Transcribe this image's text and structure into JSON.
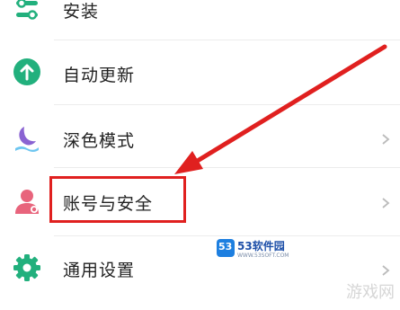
{
  "settings": {
    "items": [
      {
        "label": "安装",
        "icon": "sliders-icon"
      },
      {
        "label": "自动更新",
        "icon": "upload-circle-icon"
      },
      {
        "label": "深色模式",
        "icon": "moon-icon"
      },
      {
        "label": "账号与安全",
        "icon": "user-icon"
      },
      {
        "label": "通用设置",
        "icon": "gear-icon"
      }
    ]
  },
  "watermark": {
    "brand": "53软件园",
    "url": "WWW.53SOFT.COM",
    "logo_text": "53",
    "corner_text": "游戏网"
  },
  "colors": {
    "highlight": "#e0201f",
    "green": "#22b07d",
    "purple": "#8a63d2",
    "pink": "#e8647c"
  }
}
